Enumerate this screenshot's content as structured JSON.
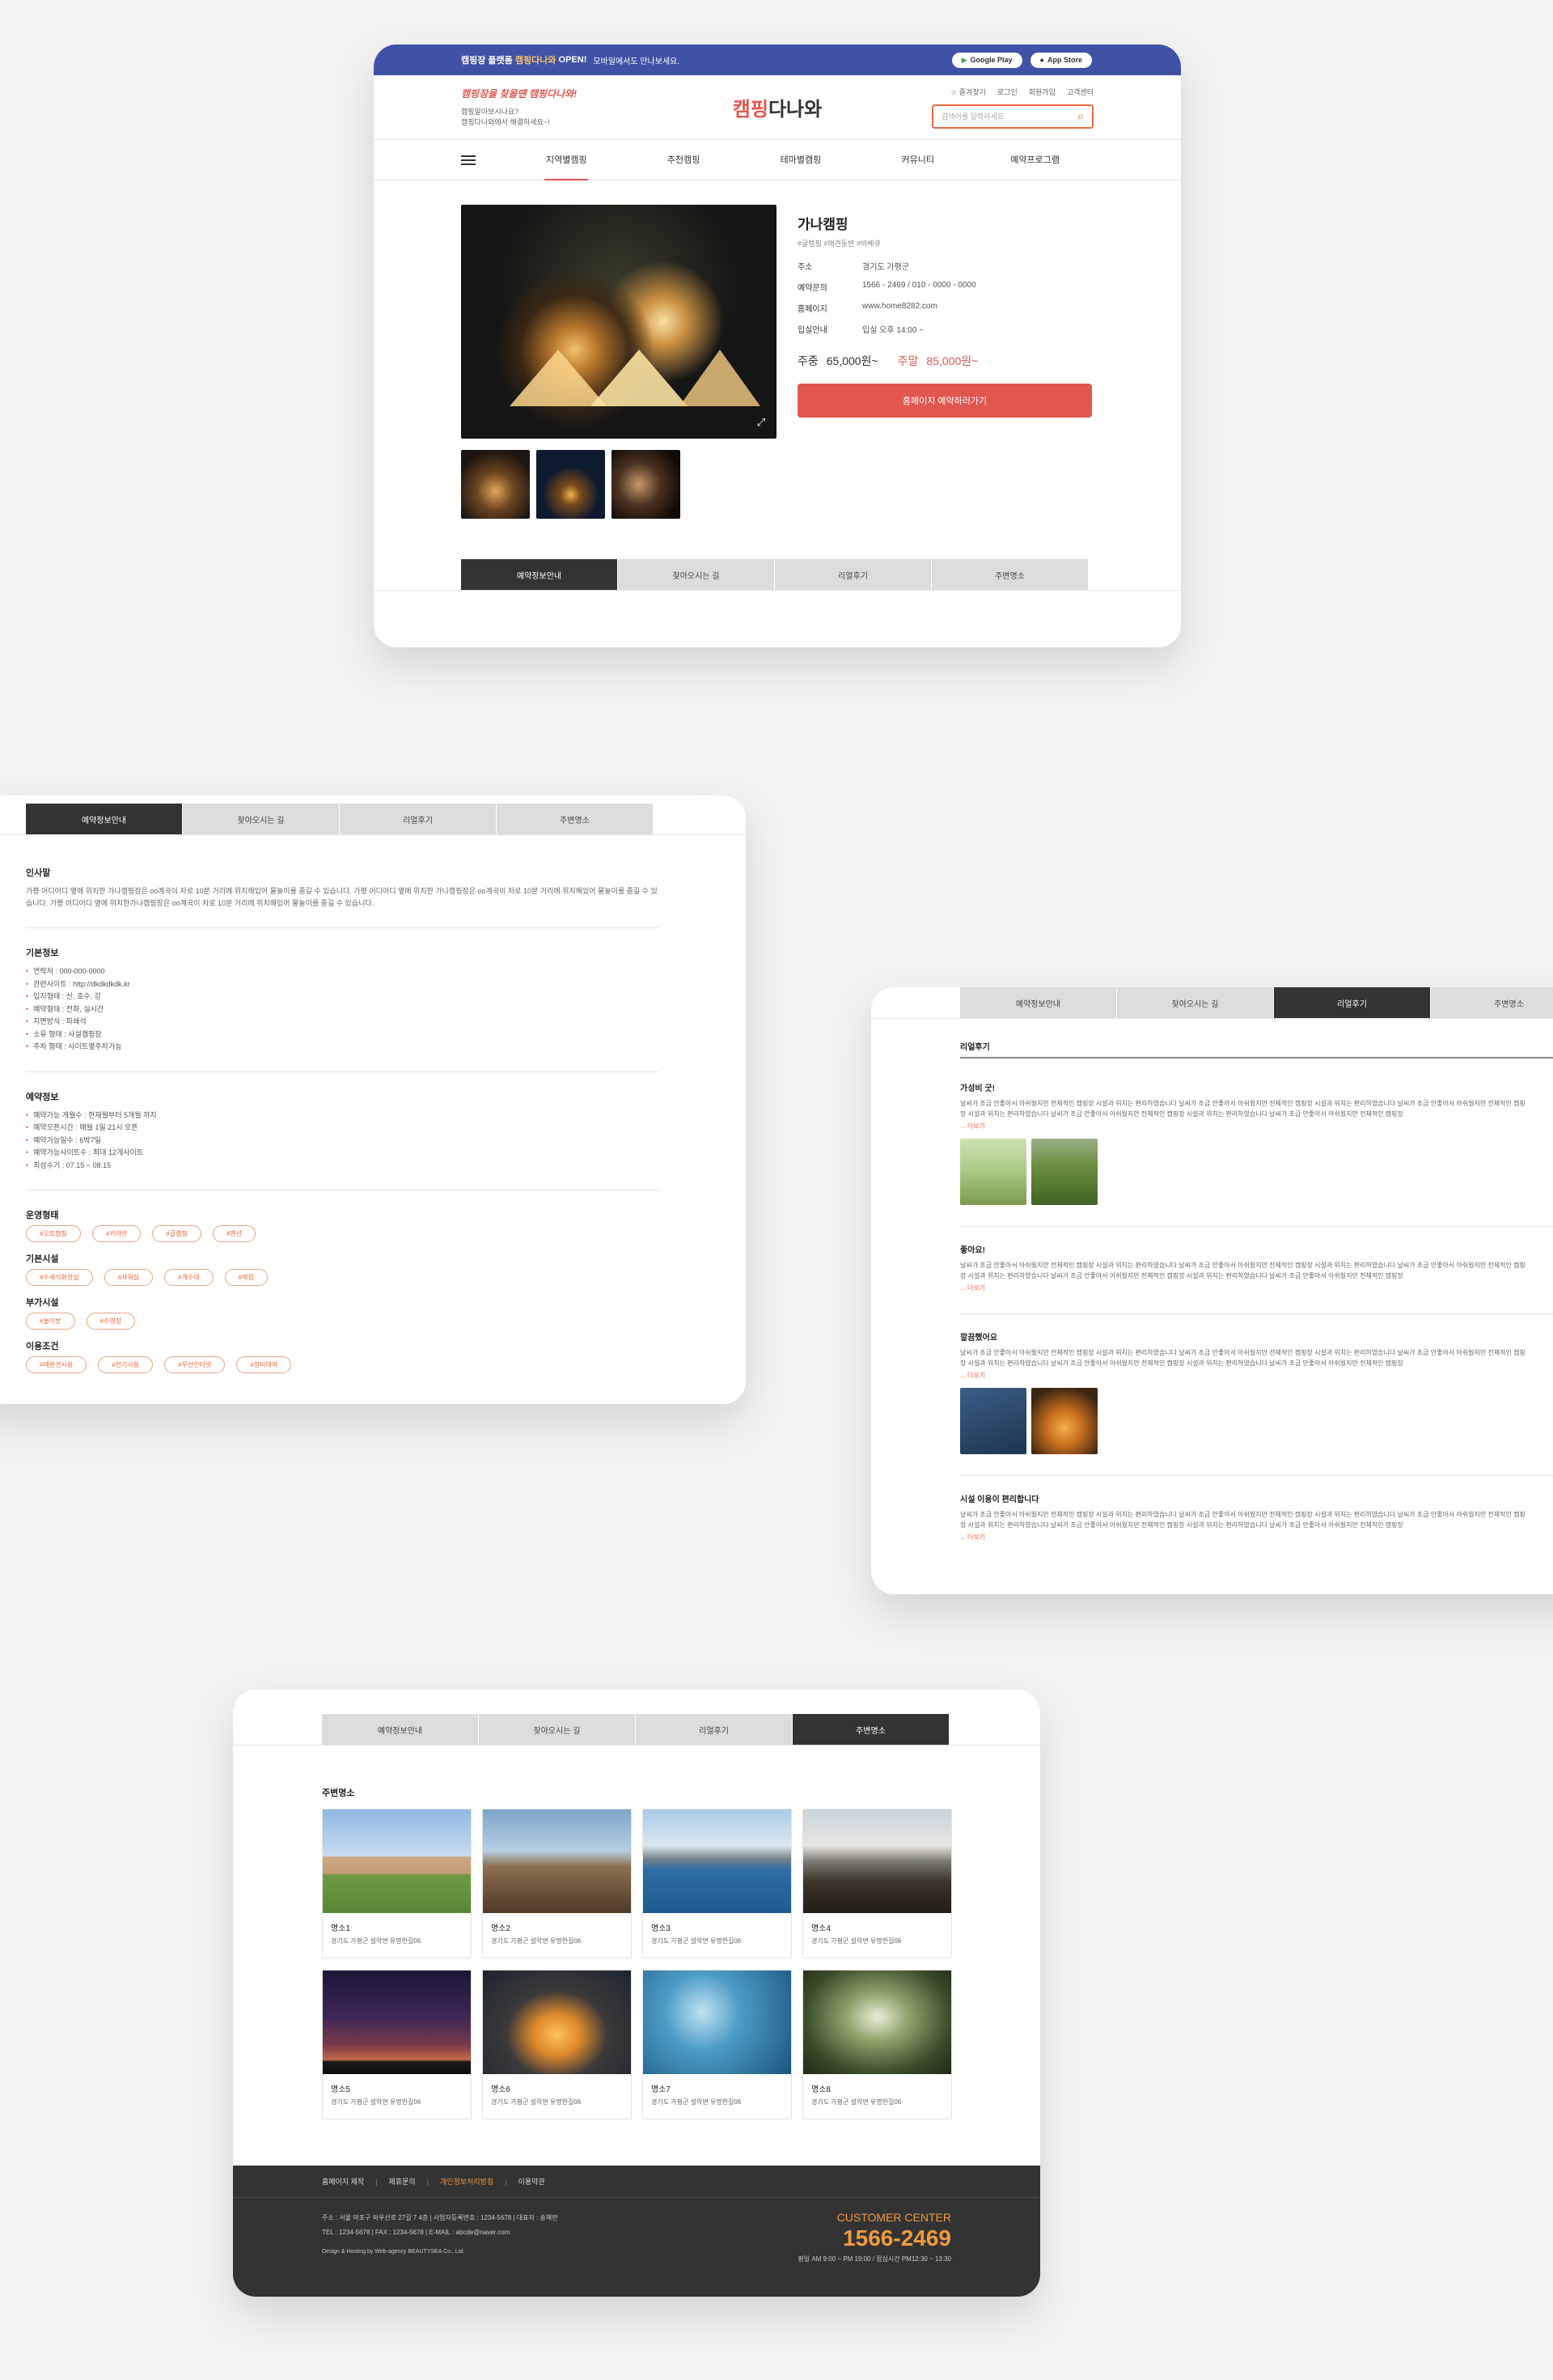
{
  "top_banner": {
    "text_pre": "캠핑장 플랫폼",
    "text_brand": "캠핑다나와",
    "text_open": "OPEN!",
    "text_sub": "모바일에서도 만나보세요.",
    "google_play": "Google Play",
    "app_store": "App Store"
  },
  "header": {
    "slogan": "캠핑장을 찾을땐 캠핑다나와!",
    "slogan_sub1": "캠핑알아보시나요?",
    "slogan_sub2": "캠핑다나와에서 해결하세요~!",
    "logo_red": "캠핑",
    "logo_rest": "다나와",
    "util": [
      "즐겨찾기",
      "로그인",
      "회원가입",
      "고객센터"
    ],
    "search_placeholder": "검색어를 입력하세요"
  },
  "gnb": [
    "지역별캠핑",
    "추천캠핑",
    "테마별캠핑",
    "커뮤니티",
    "예약프로그램"
  ],
  "camp": {
    "title": "가나캠핑",
    "tags": "#글램핑 #애견동반 #바베큐",
    "rows": [
      {
        "k": "주소",
        "v": "경기도 가평군"
      },
      {
        "k": "예약문의",
        "v": "1566 - 2469 / 010 - 0000 - 0000"
      },
      {
        "k": "홈페이지",
        "v": "www.home8282.com"
      },
      {
        "k": "입실안내",
        "v": "입실 오후 14:00 ~"
      }
    ],
    "weekday_label": "주중",
    "weekday_price": "65,000원~",
    "weekend_label": "주말",
    "weekend_price": "85,000원~",
    "book_btn": "홈페이지 예약하러가기"
  },
  "tabs": [
    "예약정보안내",
    "찾아오시는 길",
    "리얼후기",
    "주변명소"
  ],
  "reservation": {
    "greet_title": "인사말",
    "greet_text": "가평 어디어디 옆에 위치한 가나캠핑장은 oo계곡이 차로 10분 거리에 위치해있어 물놀이를 즐길 수 있습니다.  가평 어디어디 옆에 위치한 가나캠핑장은 oo계곡이 차로 10분 거리에 위치해있어 물놀이를 즐길 수 있습니다. 가평 어디어디 옆에 위치한가나캠핑장은 oo계곡이 차로 10분 거리에 위치해있어 물놀이를 즐길 수 있습니다.",
    "basic_title": "기본정보",
    "basic": [
      "연락처 : 000-000-0000",
      "관련사이트 : http://dkdkdkdk.kr",
      "입지형태 : 산, 호수, 강",
      "예약형태 : 전화, 실시간",
      "지면방식 : 파쇄석",
      "소유 형태 : 사설캠핑장",
      "주차 형태 : 사이트옆주차가능"
    ],
    "res_title": "예약정보",
    "res": [
      "예약가능 개월수 : 현재월부터 5개월 까지",
      "예약오픈시간 : 매월 1일 21시 오픈",
      "예약가능일수 : 6박7일",
      "예약가능사이트수 : 최대 12개사이트",
      "최성수기 : 07.15 ~ 08.15"
    ],
    "groups": [
      {
        "title": "운영형태",
        "chips": [
          "#오토캠핑",
          "#카라반",
          "#글램핑",
          "#펜션"
        ]
      },
      {
        "title": "기본시설",
        "chips": [
          "#수세식화장실",
          "#샤워실",
          "#개수대",
          "#매점"
        ]
      },
      {
        "title": "부가시설",
        "chips": [
          "#놀이방",
          "#수영장"
        ]
      },
      {
        "title": "이용조건",
        "chips": [
          "#애완견사용",
          "#전기사용",
          "#무선인터넷",
          "#장비대여"
        ]
      }
    ]
  },
  "reviews": {
    "title": "리얼후기",
    "more": "... 더보기",
    "items": [
      {
        "title": "가성비 굿!",
        "text": "날씨가 조금 안좋아서 아쉬웠지만 전체적인 캠핑장 시설과 위치는 편리하였습니다 날씨가 조금 안좋아서 아쉬웠지만 전체적인 캠핑장 시설과 위치는 편리하였습니다 날씨가 조금 안좋아서 아쉬웠지만 전체적인 캠핑장 시설과 위치는 편리하였습니다 날씨가 조금 안좋아서 아쉬웠지만 전체적인 캠핑장 시설과 위치는 편리하였습니다 날씨가 조금 안좋아서 아쉬웠지만 전체적인 캠핑장"
      },
      {
        "title": "좋아요!",
        "text": "날씨가 조금 안좋아서 아쉬웠지만 전체적인 캠핑장 시설과 위치는 편리하였습니다 날씨가 조금 안좋아서 아쉬웠지만 전체적인 캠핑장 시설과 위치는 편리하였습니다 날씨가 조금 안좋아서 아쉬웠지만 전체적인 캠핑장 시설과 위치는 편리하였습니다 날씨가 조금 안좋아서 아쉬웠지만 전체적인 캠핑장 시설과 위치는 편리하였습니다 날씨가 조금 안좋아서 아쉬웠지만 전체적인 캠핑장"
      },
      {
        "title": "깔끔했어요",
        "text": "날씨가 조금 안좋아서 아쉬웠지만 전체적인 캠핑장 시설과 위치는 편리하였습니다 날씨가 조금 안좋아서 아쉬웠지만 전체적인 캠핑장 시설과 위치는 편리하였습니다 날씨가 조금 안좋아서 아쉬웠지만 전체적인 캠핑장 시설과 위치는 편리하였습니다 날씨가 조금 안좋아서 아쉬웠지만 전체적인 캠핑장 시설과 위치는 편리하였습니다 날씨가 조금 안좋아서 아쉬웠지만 전체적인 캠핑장"
      },
      {
        "title": "시설 이용이 편리합니다",
        "text": "날씨가 조금 안좋아서 아쉬웠지만 전체적인 캠핑장 시설과 위치는 편리하였습니다 날씨가 조금 안좋아서 아쉬웠지만 전체적인 캠핑장 시설과 위치는 편리하였습니다 날씨가 조금 안좋아서 아쉬웠지만 전체적인 캠핑장 시설과 위치는 편리하였습니다 날씨가 조금 안좋아서 아쉬웠지만 전체적인 캠핑장 시설과 위치는 편리하였습니다 날씨가 조금 안좋아서 아쉬웠지만 전체적인 캠핑장"
      }
    ]
  },
  "nearby": {
    "title": "주변명소",
    "items": [
      {
        "name": "명소1",
        "addr": "경기도 가평군 설악면 유명한길06"
      },
      {
        "name": "명소2",
        "addr": "경기도 가평군 설악면 유명한길06"
      },
      {
        "name": "명소3",
        "addr": "경기도 가평군 설악면 유명한길06"
      },
      {
        "name": "명소4",
        "addr": "경기도 가평군 설악면 유명한길06"
      },
      {
        "name": "명소5",
        "addr": "경기도 가평군 설악면 유명한길06"
      },
      {
        "name": "명소6",
        "addr": "경기도 가평군 설악면 유명한길06"
      },
      {
        "name": "명소7",
        "addr": "경기도 가평군 설악면 유명한길06"
      },
      {
        "name": "명소8",
        "addr": "경기도 가평군 설악면 유명한길06"
      }
    ]
  },
  "footer": {
    "nav": [
      "홈페이지 제작",
      "제휴문의",
      "개인정보처리방침",
      "이용약관"
    ],
    "addr": "주소 : 서울 마포구 와우산로 27길 7 4층  |  사업자등록번호 : 1234-5678  |  대표자 : 송해란",
    "contact": "TEL : 1234-5678  |  FAX : 1234-5678  |  E-MAIL : abcde@naver.com",
    "credit": "Design & Hosting by Web-agency BEAUTYSEA Co., Ltd.",
    "cc_title": "CUSTOMER CENTER",
    "cc_number": "1566-2469",
    "cc_hours": "평일 AM 9:00 ~ PM 19:00 / 점심시간 PM12:30 ~ 13:30"
  },
  "colors": {
    "accent": "#e1574f",
    "orange": "#e56a3e",
    "top_banner": "#3f52a6",
    "dark": "#333333"
  }
}
